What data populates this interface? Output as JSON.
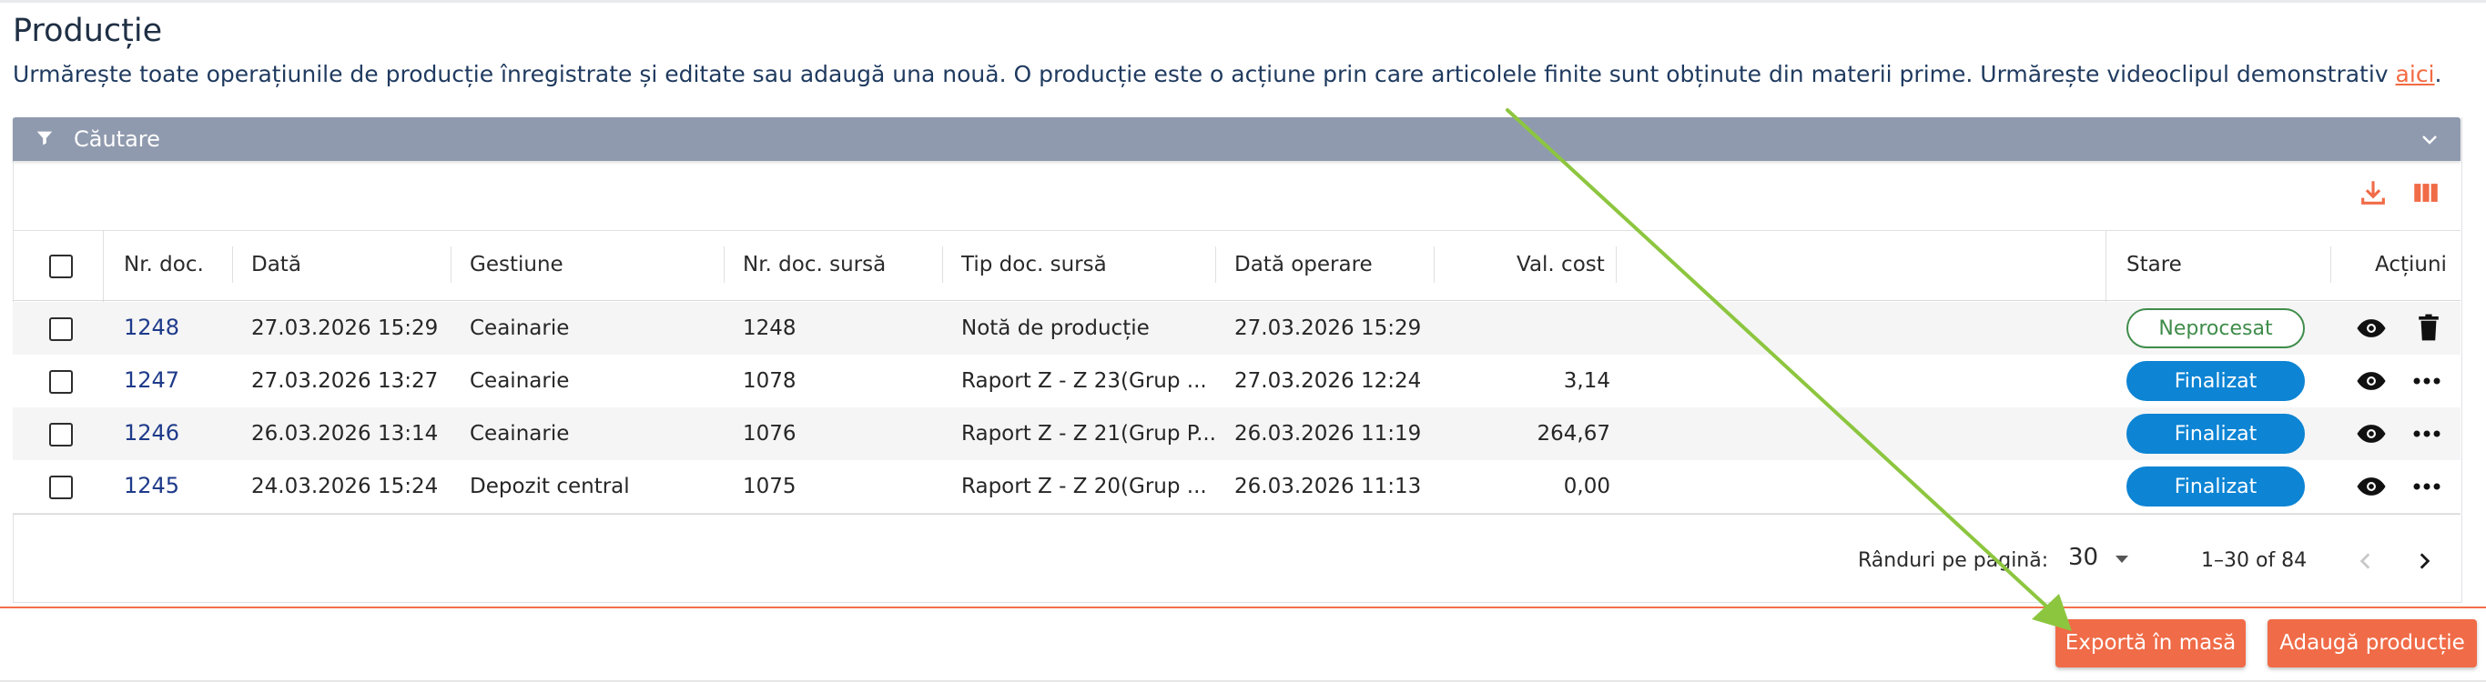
{
  "page": {
    "title": "Producție",
    "description": "Urmărește toate operațiunile de producție înregistrate și editate sau adaugă una nouă. O producție este o acțiune prin care articolele finite sunt obținute din materii prime. Urmărește videoclipul demonstrativ ",
    "link_text": "aici",
    "description_end": "."
  },
  "search": {
    "label": "Căutare"
  },
  "columns": {
    "nr_doc": "Nr. doc.",
    "data": "Dată",
    "gestiune": "Gestiune",
    "nr_doc_sursa": "Nr. doc. sursă",
    "tip_doc_sursa": "Tip doc. sursă",
    "data_operare": "Dată operare",
    "val_cost": "Val. cost",
    "stare": "Stare",
    "actiuni": "Acțiuni"
  },
  "rows": [
    {
      "nr": "1248",
      "data": "27.03.2026 15:29",
      "gestiune": "Ceainarie",
      "nr_sursa": "1248",
      "tip_sursa": "Notă de producție",
      "data_operare": "27.03.2026 15:29",
      "val_cost": "",
      "stare": "Neprocesat"
    },
    {
      "nr": "1247",
      "data": "27.03.2026 13:27",
      "gestiune": "Ceainarie",
      "nr_sursa": "1078",
      "tip_sursa": "Raport Z - Z 23(Grup ...",
      "data_operare": "27.03.2026 12:24",
      "val_cost": "3,14",
      "stare": "Finalizat"
    },
    {
      "nr": "1246",
      "data": "26.03.2026 13:14",
      "gestiune": "Ceainarie",
      "nr_sursa": "1076",
      "tip_sursa": "Raport Z - Z 21(Grup P...",
      "data_operare": "26.03.2026 11:19",
      "val_cost": "264,67",
      "stare": "Finalizat"
    },
    {
      "nr": "1245",
      "data": "24.03.2026 15:24",
      "gestiune": "Depozit central",
      "nr_sursa": "1075",
      "tip_sursa": "Raport Z - Z 20(Grup ...",
      "data_operare": "26.03.2026 11:13",
      "val_cost": "0,00",
      "stare": "Finalizat"
    }
  ],
  "pagination": {
    "rows_per_page_label": "Rânduri pe pagină:",
    "rows_per_page": "30",
    "range": "1–30 of 84"
  },
  "buttons": {
    "export": "Exportă în masă",
    "add": "Adaugă producție"
  },
  "colors": {
    "accent": "#f06b47",
    "search_bar": "#8f9aae",
    "finalizat": "#0d84d4",
    "neprocesat": "#3f8c4a",
    "annotation_arrow": "#8cc63f"
  },
  "icons": {
    "filter": "filter-icon",
    "chevron": "chevron-down-icon",
    "download": "download-icon",
    "columns": "columns-icon",
    "view": "eye-icon",
    "delete": "trash-icon",
    "more": "more-horizontal-icon",
    "prev": "chevron-left-icon",
    "next": "chevron-right-icon"
  }
}
